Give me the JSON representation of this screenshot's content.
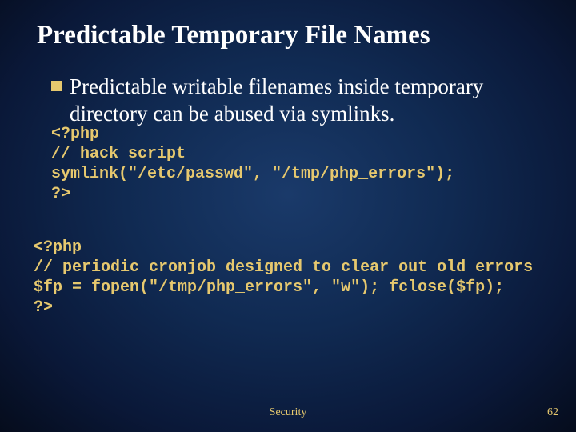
{
  "title": "Predictable Temporary File Names",
  "bullet": "Predictable writable filenames inside temporary directory can be abused via symlinks.",
  "code1": {
    "l1": "<?php",
    "l2": "// hack script",
    "l3": "symlink(\"/etc/passwd\", \"/tmp/php_errors\");",
    "l4": "?>"
  },
  "code2": {
    "l1": "<?php",
    "l2": "// periodic cronjob designed to clear out old errors",
    "l3": "$fp = fopen(\"/tmp/php_errors\", \"w\"); fclose($fp);",
    "l4": "?>"
  },
  "footer": {
    "label": "Security",
    "page": "62"
  }
}
